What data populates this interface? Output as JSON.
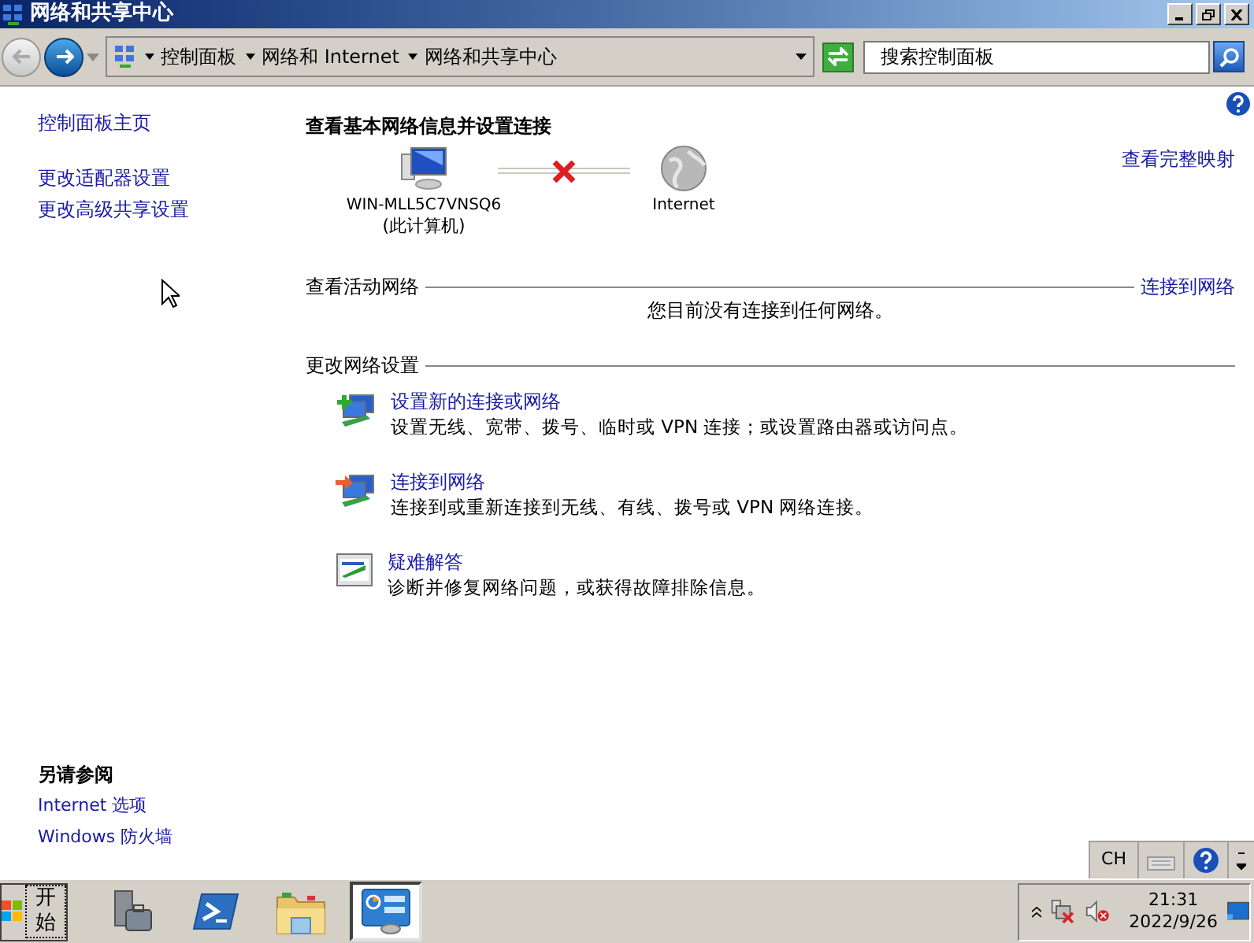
{
  "window": {
    "title": "网络和共享中心"
  },
  "address_bar": {
    "breadcrumbs": [
      "控制面板",
      "网络和 Internet",
      "网络和共享中心"
    ]
  },
  "search": {
    "placeholder": "搜索控制面板"
  },
  "sidebar": {
    "links": [
      "控制面板主页",
      "更改适配器设置",
      "更改高级共享设置"
    ],
    "see_also": {
      "title": "另请参阅",
      "links": [
        "Internet 选项",
        "Windows 防火墙"
      ]
    }
  },
  "main": {
    "heading": "查看基本网络信息并设置连接",
    "view_full_map": "查看完整映射",
    "map": {
      "computer_name": "WIN-MLL5C7VNSQ6",
      "computer_note": "(此计算机)",
      "internet_label": "Internet",
      "connected": false
    },
    "active_networks": {
      "title": "查看活动网络",
      "connect_link": "连接到网络",
      "message": "您目前没有连接到任何网络。"
    },
    "change_settings": {
      "title": "更改网络设置",
      "tasks": [
        {
          "kind": "new",
          "title": "设置新的连接或网络",
          "description": "设置无线、宽带、拨号、临时或 VPN 连接；或设置路由器或访问点。"
        },
        {
          "kind": "connect",
          "title": "连接到网络",
          "description": "连接到或重新连接到无线、有线、拨号或 VPN 网络连接。"
        },
        {
          "kind": "troubleshoot",
          "title": "疑难解答",
          "description": "诊断并修复网络问题，或获得故障排除信息。"
        }
      ]
    }
  },
  "language_bar": {
    "language": "CH"
  },
  "taskbar": {
    "start": "开始",
    "apps": [
      {
        "kind": "server",
        "selected": false
      },
      {
        "kind": "powershell",
        "selected": false
      },
      {
        "kind": "folder",
        "selected": false
      },
      {
        "kind": "control-panel",
        "selected": true
      }
    ],
    "clock": {
      "time": "21:31",
      "date": "2022/9/26"
    }
  }
}
